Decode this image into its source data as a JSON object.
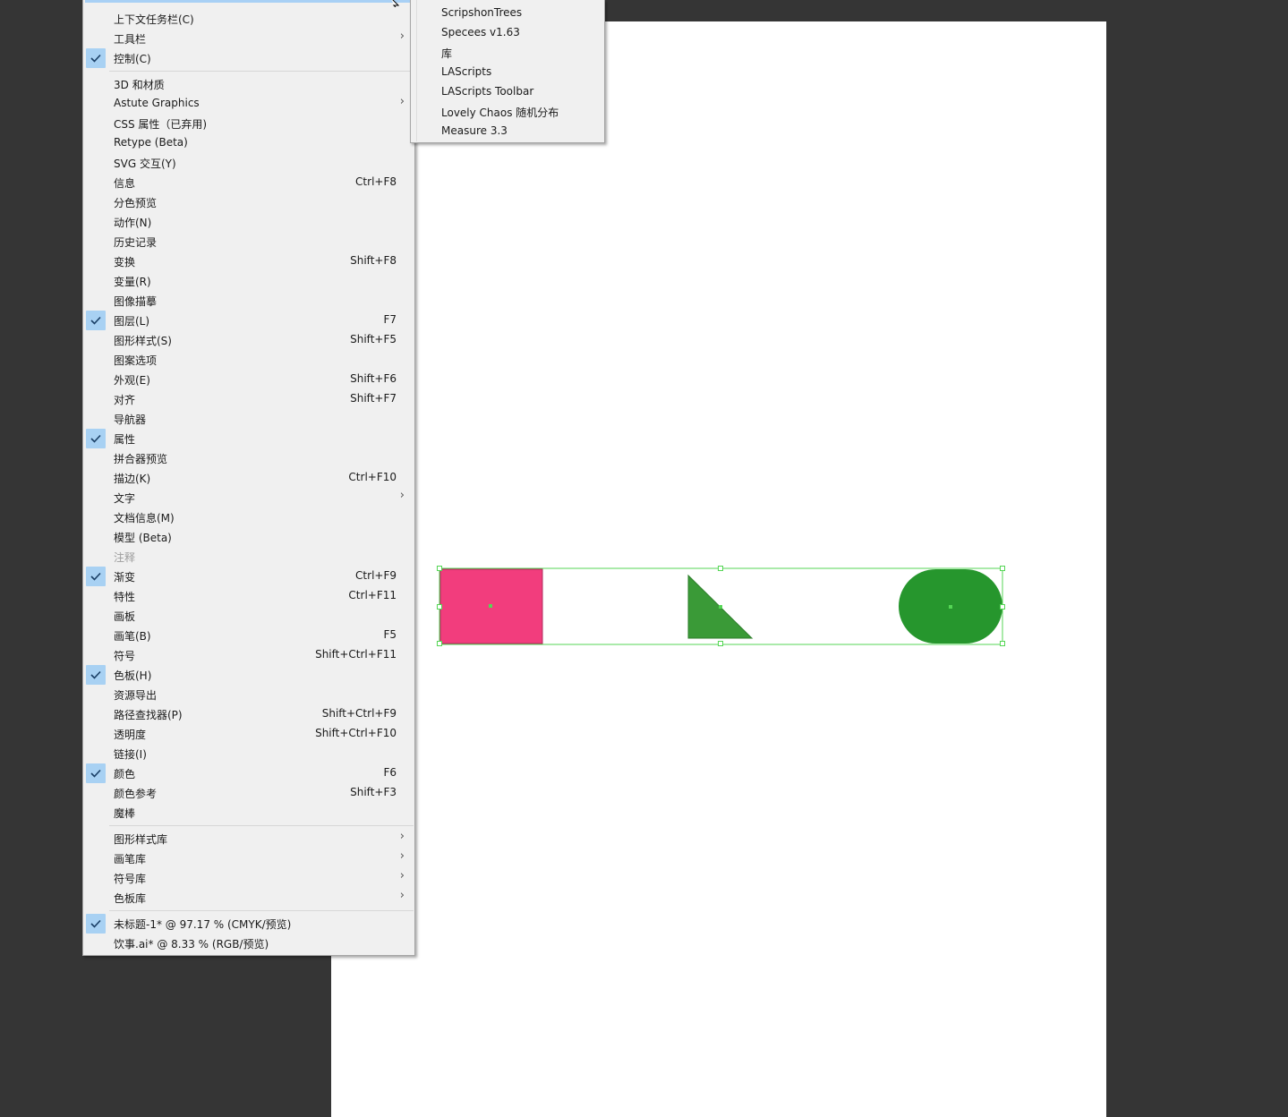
{
  "window_menu": {
    "items": [
      {
        "label": "上下文任务栏(C)",
        "shortcut": "",
        "checked": false,
        "submenu": false,
        "disabled": false
      },
      {
        "label": "工具栏",
        "shortcut": "",
        "checked": false,
        "submenu": true,
        "disabled": false
      },
      {
        "label": "控制(C)",
        "shortcut": "",
        "checked": true,
        "submenu": false,
        "disabled": false
      },
      {
        "label": "3D 和材质",
        "shortcut": "",
        "checked": false,
        "submenu": false,
        "disabled": false
      },
      {
        "label": "Astute Graphics",
        "shortcut": "",
        "checked": false,
        "submenu": true,
        "disabled": false
      },
      {
        "label": "CSS 属性（已弃用)",
        "shortcut": "",
        "checked": false,
        "submenu": false,
        "disabled": false
      },
      {
        "label": "Retype (Beta)",
        "shortcut": "",
        "checked": false,
        "submenu": false,
        "disabled": false
      },
      {
        "label": "SVG 交互(Y)",
        "shortcut": "",
        "checked": false,
        "submenu": false,
        "disabled": false
      },
      {
        "label": "信息",
        "shortcut": "Ctrl+F8",
        "checked": false,
        "submenu": false,
        "disabled": false
      },
      {
        "label": "分色预览",
        "shortcut": "",
        "checked": false,
        "submenu": false,
        "disabled": false
      },
      {
        "label": "动作(N)",
        "shortcut": "",
        "checked": false,
        "submenu": false,
        "disabled": false
      },
      {
        "label": "历史记录",
        "shortcut": "",
        "checked": false,
        "submenu": false,
        "disabled": false
      },
      {
        "label": "变换",
        "shortcut": "Shift+F8",
        "checked": false,
        "submenu": false,
        "disabled": false
      },
      {
        "label": "变量(R)",
        "shortcut": "",
        "checked": false,
        "submenu": false,
        "disabled": false
      },
      {
        "label": "图像描摹",
        "shortcut": "",
        "checked": false,
        "submenu": false,
        "disabled": false
      },
      {
        "label": "图层(L)",
        "shortcut": "F7",
        "checked": true,
        "submenu": false,
        "disabled": false
      },
      {
        "label": "图形样式(S)",
        "shortcut": "Shift+F5",
        "checked": false,
        "submenu": false,
        "disabled": false
      },
      {
        "label": "图案选项",
        "shortcut": "",
        "checked": false,
        "submenu": false,
        "disabled": false
      },
      {
        "label": "外观(E)",
        "shortcut": "Shift+F6",
        "checked": false,
        "submenu": false,
        "disabled": false
      },
      {
        "label": "对齐",
        "shortcut": "Shift+F7",
        "checked": false,
        "submenu": false,
        "disabled": false
      },
      {
        "label": "导航器",
        "shortcut": "",
        "checked": false,
        "submenu": false,
        "disabled": false
      },
      {
        "label": "属性",
        "shortcut": "",
        "checked": true,
        "submenu": false,
        "disabled": false
      },
      {
        "label": "拼合器预览",
        "shortcut": "",
        "checked": false,
        "submenu": false,
        "disabled": false
      },
      {
        "label": "描边(K)",
        "shortcut": "Ctrl+F10",
        "checked": false,
        "submenu": false,
        "disabled": false
      },
      {
        "label": "文字",
        "shortcut": "",
        "checked": false,
        "submenu": true,
        "disabled": false
      },
      {
        "label": "文档信息(M)",
        "shortcut": "",
        "checked": false,
        "submenu": false,
        "disabled": false
      },
      {
        "label": "模型 (Beta)",
        "shortcut": "",
        "checked": false,
        "submenu": false,
        "disabled": false
      },
      {
        "label": "注释",
        "shortcut": "",
        "checked": false,
        "submenu": false,
        "disabled": true
      },
      {
        "label": "渐变",
        "shortcut": "Ctrl+F9",
        "checked": true,
        "submenu": false,
        "disabled": false
      },
      {
        "label": "特性",
        "shortcut": "Ctrl+F11",
        "checked": false,
        "submenu": false,
        "disabled": false
      },
      {
        "label": "画板",
        "shortcut": "",
        "checked": false,
        "submenu": false,
        "disabled": false
      },
      {
        "label": "画笔(B)",
        "shortcut": "F5",
        "checked": false,
        "submenu": false,
        "disabled": false
      },
      {
        "label": "符号",
        "shortcut": "Shift+Ctrl+F11",
        "checked": false,
        "submenu": false,
        "disabled": false
      },
      {
        "label": "色板(H)",
        "shortcut": "",
        "checked": true,
        "submenu": false,
        "disabled": false
      },
      {
        "label": "资源导出",
        "shortcut": "",
        "checked": false,
        "submenu": false,
        "disabled": false
      },
      {
        "label": "路径查找器(P)",
        "shortcut": "Shift+Ctrl+F9",
        "checked": false,
        "submenu": false,
        "disabled": false
      },
      {
        "label": "透明度",
        "shortcut": "Shift+Ctrl+F10",
        "checked": false,
        "submenu": false,
        "disabled": false
      },
      {
        "label": "链接(I)",
        "shortcut": "",
        "checked": false,
        "submenu": false,
        "disabled": false
      },
      {
        "label": "颜色",
        "shortcut": "F6",
        "checked": true,
        "submenu": false,
        "disabled": false
      },
      {
        "label": "颜色参考",
        "shortcut": "Shift+F3",
        "checked": false,
        "submenu": false,
        "disabled": false
      },
      {
        "label": "魔棒",
        "shortcut": "",
        "checked": false,
        "submenu": false,
        "disabled": false
      },
      {
        "label": "图形样式库",
        "shortcut": "",
        "checked": false,
        "submenu": true,
        "disabled": false
      },
      {
        "label": "画笔库",
        "shortcut": "",
        "checked": false,
        "submenu": true,
        "disabled": false
      },
      {
        "label": "符号库",
        "shortcut": "",
        "checked": false,
        "submenu": true,
        "disabled": false
      },
      {
        "label": "色板库",
        "shortcut": "",
        "checked": false,
        "submenu": true,
        "disabled": false
      },
      {
        "label": "未标题-1* @ 97.17 % (CMYK/预览)",
        "shortcut": "",
        "checked": true,
        "submenu": false,
        "disabled": false
      },
      {
        "label": "饮事.ai* @ 8.33 % (RGB/预览)",
        "shortcut": "",
        "checked": false,
        "submenu": false,
        "disabled": false
      }
    ]
  },
  "extensions_submenu": {
    "items": [
      "ScripshonTrees",
      "Specees v1.63",
      "库",
      "LAScripts",
      "LAScripts Toolbar",
      "Lovely Chaos 随机分布",
      "Measure 3.3"
    ]
  },
  "icons": {
    "checkmark": "checkmark-icon",
    "submenu_arrow": "chevron-right-icon",
    "cursor": "mouse-cursor-icon"
  },
  "colors": {
    "canvas_bg": "#353535",
    "artboard": "#ffffff",
    "menu_bg": "#f0f0f0",
    "check_bg": "#a8d1f3",
    "rectangle_fill": "#f23d7d",
    "triangle_fill": "#3a9a37",
    "capsule_fill": "#26962d",
    "selection": "#55d655"
  }
}
